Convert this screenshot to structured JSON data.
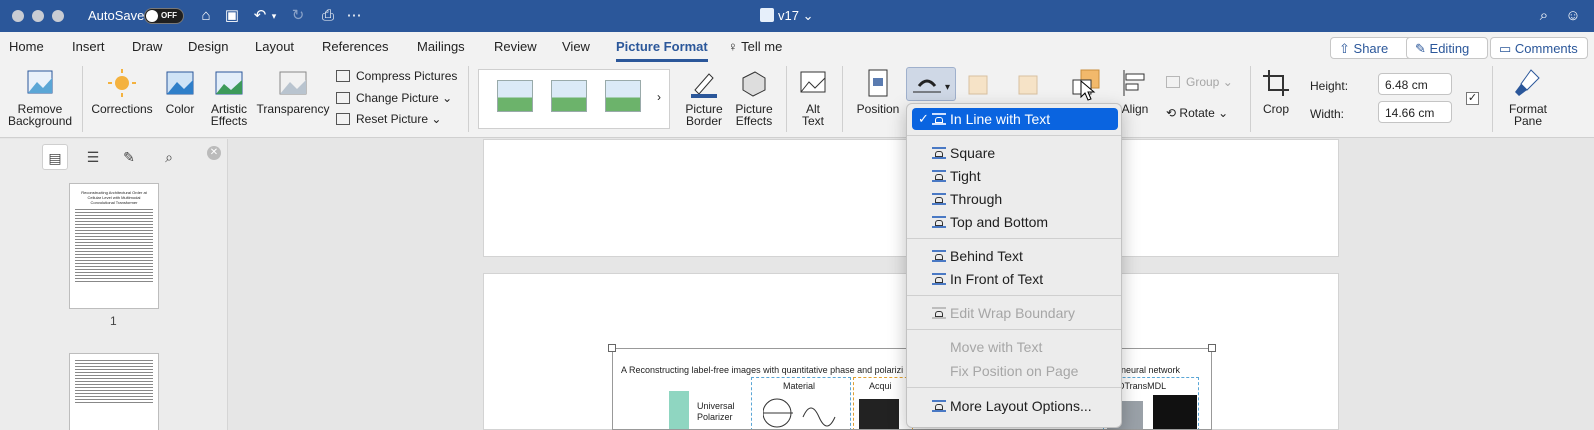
{
  "titlebar": {
    "autosave_label": "AutoSave",
    "autosave_state": "OFF",
    "doc_title": "v17"
  },
  "tabs": [
    "Home",
    "Insert",
    "Draw",
    "Design",
    "Layout",
    "References",
    "Mailings",
    "Review",
    "View",
    "Picture Format"
  ],
  "tell_me": "Tell me",
  "share_label": "Share",
  "editing_label": "Editing",
  "comments_label": "Comments",
  "ribbon": {
    "remove_background": [
      "Remove",
      "Background"
    ],
    "corrections": "Corrections",
    "color": "Color",
    "artistic_effects": [
      "Artistic",
      "Effects"
    ],
    "transparency": "Transparency",
    "compress_pictures": "Compress Pictures",
    "change_picture": "Change Picture",
    "reset_picture": "Reset Picture",
    "picture_border": [
      "Picture",
      "Border"
    ],
    "picture_effects": [
      "Picture",
      "Effects"
    ],
    "alt_text": [
      "Alt",
      "Text"
    ],
    "position": "Position",
    "align": "Align",
    "group": "Group",
    "rotate": "Rotate",
    "crop": "Crop",
    "height_label": "Height:",
    "height_value": "6.48 cm",
    "width_label": "Width:",
    "width_value": "14.66 cm",
    "format_pane": [
      "Format",
      "Pane"
    ]
  },
  "nav": {
    "page_number": "1",
    "thumb_title": "Reconstructing Architectural Order at Cellular Level with Multimodal Convolutional Transformer"
  },
  "figure": {
    "caption": "A  Reconstructing label-free images with quantitative phase and polarizi",
    "caption_tail": "neural network",
    "universal_polarizer": [
      "Universal",
      "Polarizer"
    ],
    "material": "Material",
    "acquire": "Acqui",
    "model": "3DTransMDL"
  },
  "menu": {
    "items": [
      {
        "label": "In Line with Text",
        "checked": true,
        "highlighted": true,
        "disabled": false
      },
      {
        "label": "Square",
        "checked": false,
        "highlighted": false,
        "disabled": false
      },
      {
        "label": "Tight",
        "checked": false,
        "highlighted": false,
        "disabled": false
      },
      {
        "label": "Through",
        "checked": false,
        "highlighted": false,
        "disabled": false
      },
      {
        "label": "Top and Bottom",
        "checked": false,
        "highlighted": false,
        "disabled": false
      },
      {
        "label": "Behind Text",
        "checked": false,
        "highlighted": false,
        "disabled": false
      },
      {
        "label": "In Front of Text",
        "checked": false,
        "highlighted": false,
        "disabled": false
      },
      {
        "label": "Edit Wrap Boundary",
        "checked": false,
        "highlighted": false,
        "disabled": true
      },
      {
        "label": "Move with Text",
        "checked": false,
        "highlighted": false,
        "disabled": true
      },
      {
        "label": "Fix Position on Page",
        "checked": false,
        "highlighted": false,
        "disabled": true
      },
      {
        "label": "More Layout Options...",
        "checked": false,
        "highlighted": false,
        "disabled": false
      }
    ]
  },
  "colors": {
    "brand": "#2b579a",
    "menu_highlight": "#0a64e0"
  }
}
